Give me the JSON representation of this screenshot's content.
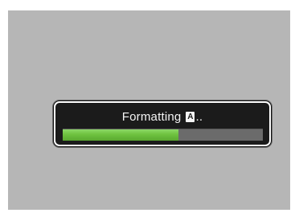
{
  "dialog": {
    "message": "Formatting",
    "drive_icon": "A",
    "drive_icon_name": "drive-a-icon",
    "ellipsis": ".."
  },
  "progress": {
    "fraction": 0.58
  },
  "colors": {
    "background": "#b6b6b6",
    "dialog": "#1b1b1b",
    "progress_fill": "#6ec23f",
    "progress_track": "#6b6b6b"
  }
}
